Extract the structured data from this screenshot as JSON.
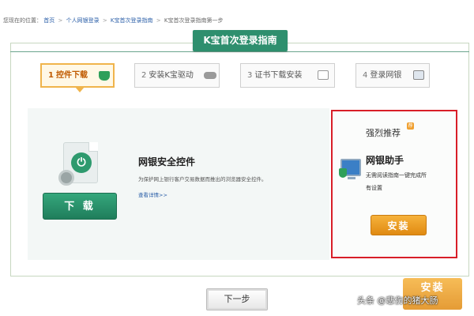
{
  "breadcrumb": {
    "label": "您现在的位置：",
    "items": [
      "首页",
      "个人网银登录",
      "K宝首次登录指南",
      "K宝首次登录指南第一步"
    ],
    "separator": ">"
  },
  "guide_title": "K宝首次登录指南",
  "steps": [
    {
      "num": "1",
      "label": "控件下载",
      "icon": "shield-icon",
      "active": true
    },
    {
      "num": "2",
      "label": "安装K宝驱动",
      "icon": "usb-key-icon",
      "active": false
    },
    {
      "num": "3",
      "label": "证书下载安装",
      "icon": "certificate-icon",
      "active": false
    },
    {
      "num": "4",
      "label": "登录网银",
      "icon": "monitor-icon",
      "active": false
    }
  ],
  "control": {
    "title": "网银安全控件",
    "description": "为保护网上银行客户交易数据而推出的浏览器安全控件。",
    "more_link": "查看详情>>",
    "download_label": "下 载"
  },
  "recommend": {
    "title": "强烈推荐",
    "badge": "荐",
    "helper_title": "网银助手",
    "helper_desc": "无需阅读指南一键完成所有设置",
    "install_label": "安装"
  },
  "ghost_install_label": "安装",
  "next_label": "下一步",
  "watermark": "头条 @悲伤的猪大肠",
  "colors": {
    "primary_green": "#2e8f6e",
    "active_orange": "#f0b44b",
    "install_orange": "#e08a12",
    "highlight_red": "#d81e28"
  }
}
